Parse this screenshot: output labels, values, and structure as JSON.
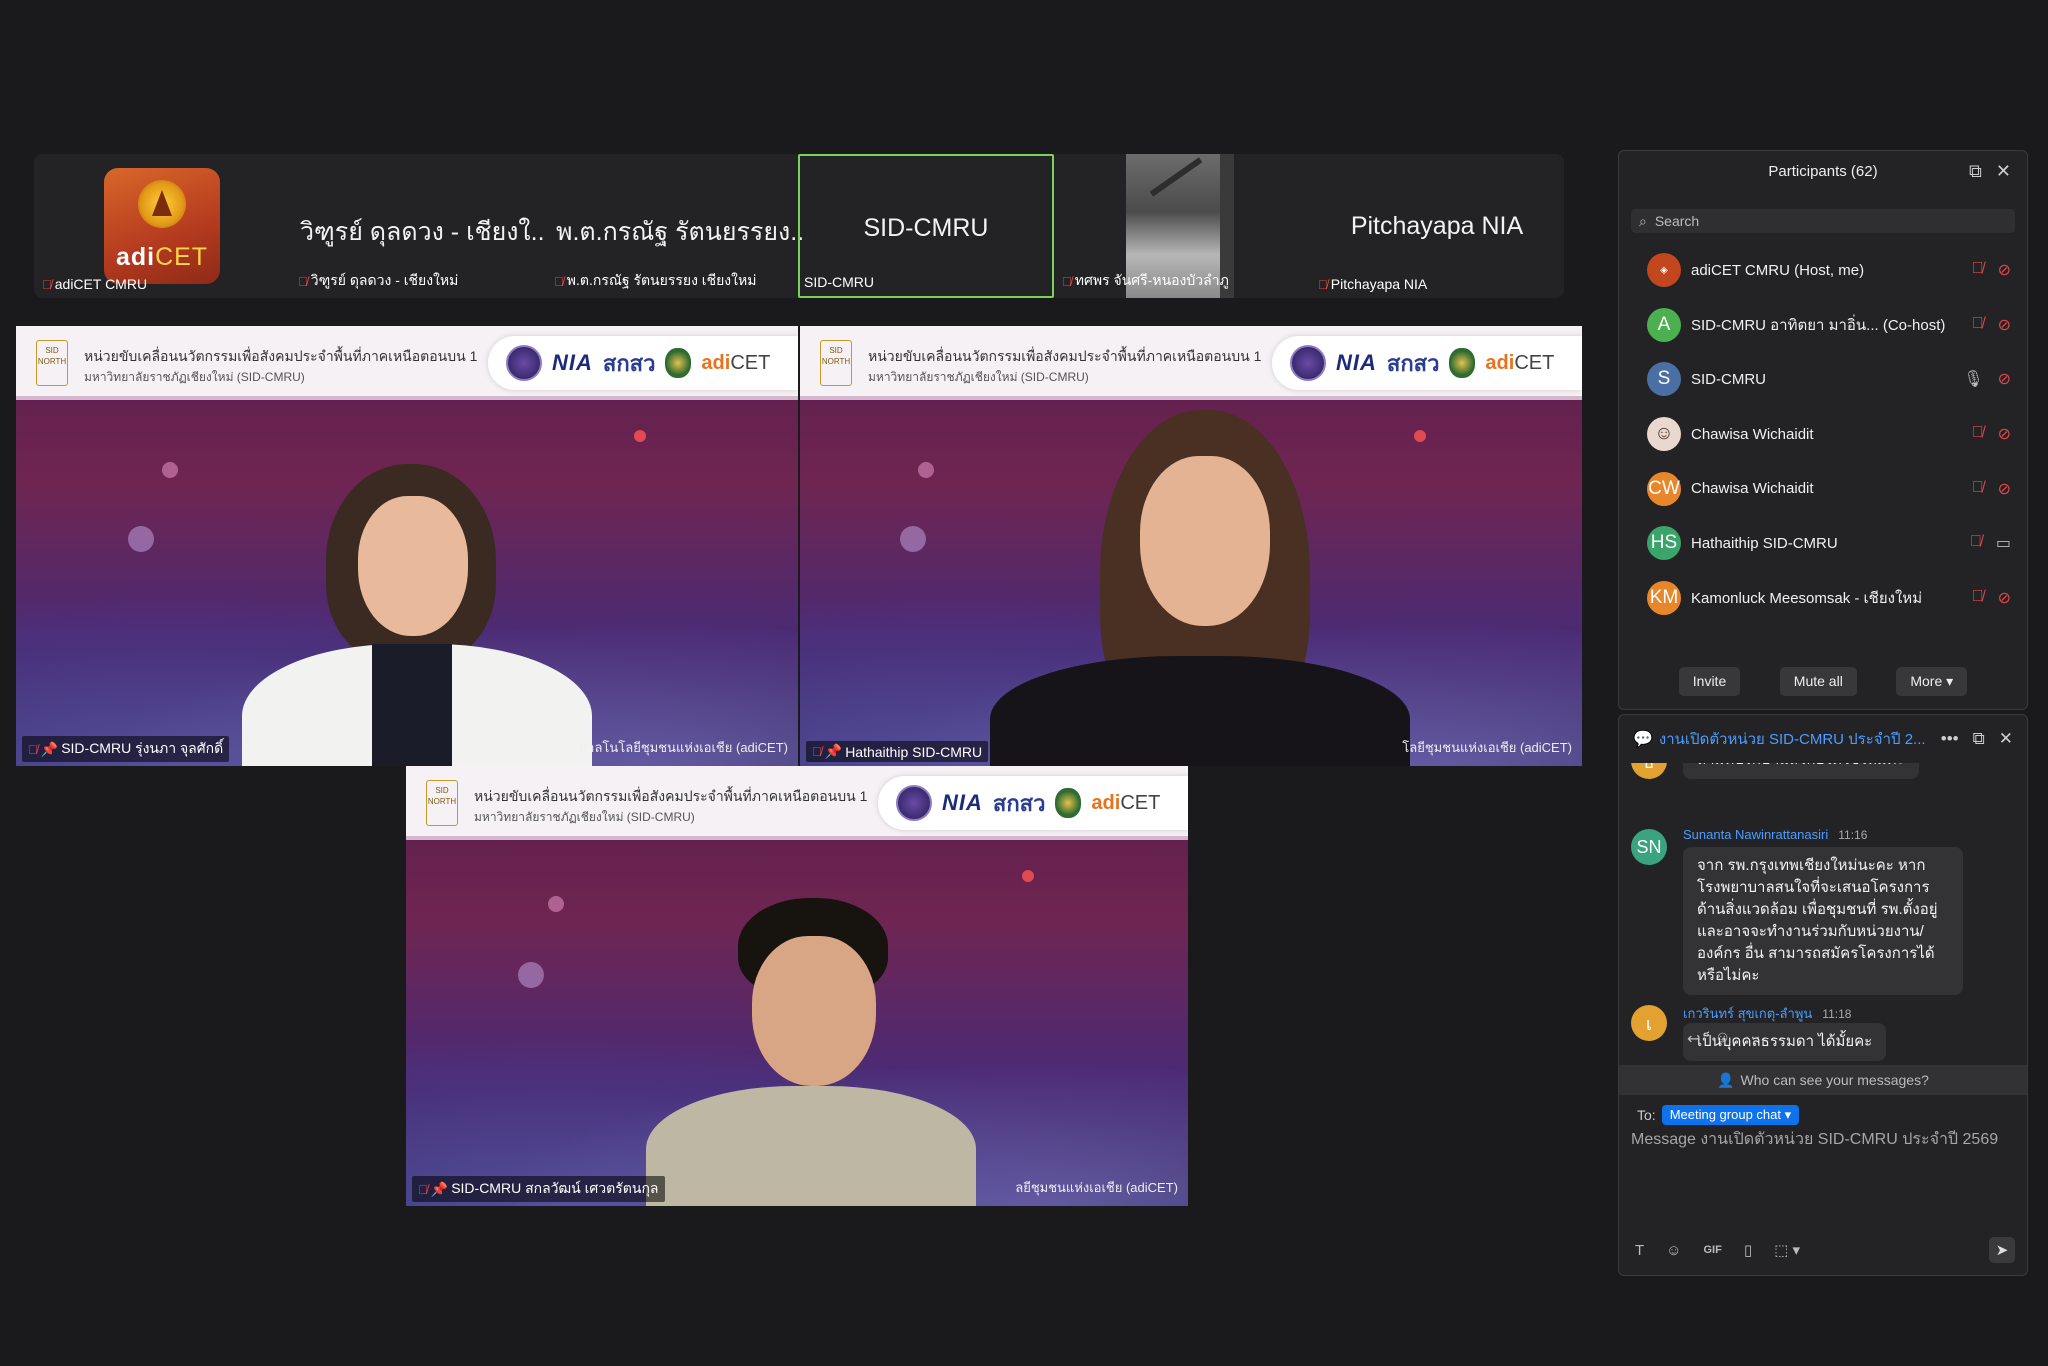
{
  "strip": {
    "thumbs": [
      {
        "label": "adiCET CMRU",
        "logo_text_a": "adi",
        "logo_text_b": "CET"
      },
      {
        "big": "วิฑูรย์ ดุลดวง - เชียงใ...",
        "label": "วิฑูรย์ ดุลดวง - เชียงใหม่"
      },
      {
        "big": "พ.ต.กรณัฐ รัตนยรรยง...",
        "label": "พ.ต.กรณัฐ รัตนยรรยง เชียงใหม่"
      },
      {
        "big": "SID-CMRU",
        "label": "SID-CMRU"
      },
      {
        "label": "ทศพร จันศรี-หนองบัวลำภู"
      },
      {
        "big": "Pitchayapa NIA",
        "label": "Pitchayapa NIA"
      }
    ]
  },
  "banner": {
    "line1": "หน่วยขับเคลื่อนนวัตกรรมเพื่อสังคมประจำพื้นที่ภาคเหนือตอนบน 1",
    "line2": "มหาวิทยาลัยราชภัฏเชียงใหม่ (SID-CMRU)",
    "sid_badge": "SID NORTH",
    "nia": "NIA",
    "skw": "สกสว",
    "adi_a": "adi",
    "adi_b": "CET"
  },
  "tiles": [
    {
      "label": "SID-CMRU รุ่งนภา จุลศักดิ์",
      "watermark": "ศาลโนโลยีชุมชนแห่งเอเชีย (adiCET)"
    },
    {
      "label": "Hathaithip SID-CMRU",
      "watermark": "โลยีชุมชนแห่งเอเชีย (adiCET)"
    },
    {
      "label": "SID-CMRU สกลวัฒน์ เศวตรัตนกุล",
      "watermark": "ลยีชุมชนแห่งเอเชีย (adiCET)"
    }
  ],
  "participants": {
    "title": "Participants (62)",
    "search_placeholder": "Search",
    "list": [
      {
        "initials": "",
        "name": "adiCET CMRU (Host, me)",
        "color": "#c2461e"
      },
      {
        "initials": "A",
        "name": "SID-CMRU อาทิตยา มาอิ่น...  (Co-host)",
        "color": "#4caf50"
      },
      {
        "initials": "S",
        "name": "SID-CMRU",
        "color": "#4a6fa5"
      },
      {
        "initials": "",
        "name": "Chawisa Wichaidit",
        "color": "#e8d8cf"
      },
      {
        "initials": "CW",
        "name": "Chawisa Wichaidit",
        "color": "#e8872a"
      },
      {
        "initials": "HS",
        "name": "Hathaithip SID-CMRU",
        "color": "#3aa46b"
      },
      {
        "initials": "KM",
        "name": "Kamonluck Meesomsak - เชียงใหม่",
        "color": "#e8872a"
      }
    ],
    "buttons": {
      "invite": "Invite",
      "mute_all": "Mute all",
      "more": "More"
    }
  },
  "chat": {
    "title": "งานเปิดตัวหน่วย SID-CMRU ประจำปี 2...",
    "messages": [
      {
        "initials": "ธ",
        "color": "#e2a130",
        "name": "",
        "time": "",
        "text": "ถ้ามีที่ปรึกษาแล้วก่อได้ใช่ไหมคะ"
      },
      {
        "initials": "SN",
        "color": "#3aa37f",
        "name": "Sunanta Nawinrattanasiri",
        "time": "11:16",
        "text": "จาก  รพ.กรุงเทพเชียงใหม่นะคะ หาก โรงพยาบาลสนใจที่จะเสนอโครงการด้านสิ่งแวดล้อม เพื่อชุมชนที่ รพ.ตั้งอยู่ และอาจจะทำงานร่วมกับหน่วยงาน/องค์กร อื่น สามารถสมัครโครงการได้หรือไม่คะ"
      },
      {
        "initials": "เ",
        "color": "#e2a130",
        "name": "เกวรินทร์ สุขเกตุ-ลำพูน",
        "time": "11:18",
        "text": "เป็นบุคคลธรรมดา ได้มั้ยคะ"
      }
    ],
    "who_see": "Who can see your messages?",
    "to_label": "To:",
    "to_target": "Meeting group chat",
    "input_placeholder": "Message งานเปิดตัวหน่วย SID-CMRU ประจำปี 2569",
    "gif": "GIF"
  }
}
